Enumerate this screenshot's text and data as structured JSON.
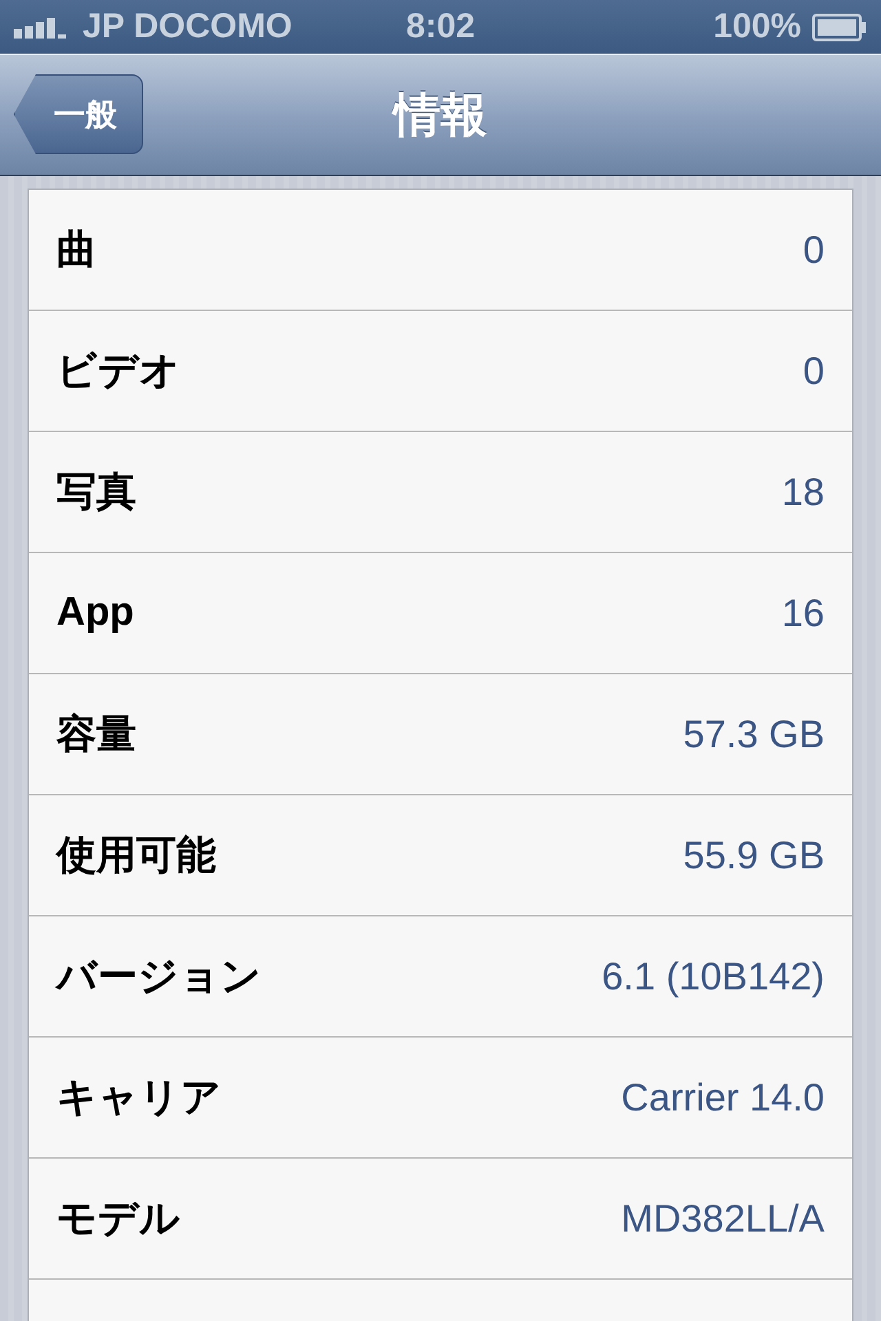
{
  "status_bar": {
    "carrier": "JP DOCOMO",
    "time": "8:02",
    "battery": "100%"
  },
  "nav_bar": {
    "back_button": "一般",
    "title": "情報"
  },
  "rows": [
    {
      "label": "曲",
      "value": "0"
    },
    {
      "label": "ビデオ",
      "value": "0"
    },
    {
      "label": "写真",
      "value": "18"
    },
    {
      "label": "App",
      "value": "16"
    },
    {
      "label": "容量",
      "value": "57.3 GB"
    },
    {
      "label": "使用可能",
      "value": "55.9 GB"
    },
    {
      "label": "バージョン",
      "value": "6.1 (10B142)"
    },
    {
      "label": "キャリア",
      "value": "Carrier 14.0"
    },
    {
      "label": "モデル",
      "value": "MD382LL/A"
    }
  ]
}
